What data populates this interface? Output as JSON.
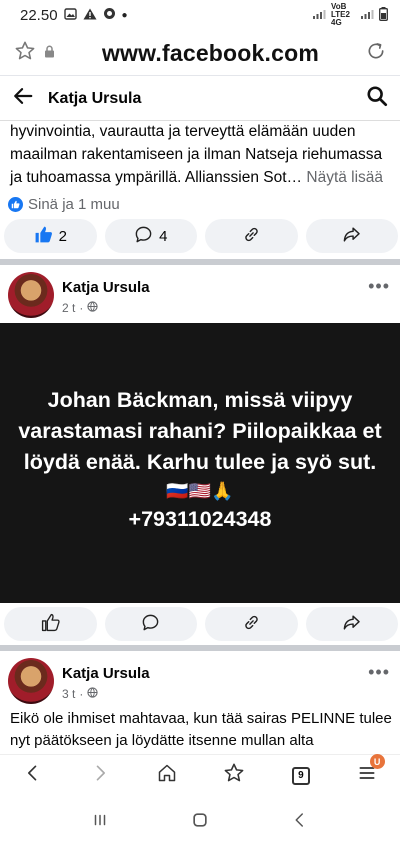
{
  "status": {
    "time": "22.50",
    "network": "VoB LTE2 4G",
    "signal": "signal",
    "battery": "battery"
  },
  "browser": {
    "url": "www.facebook.com"
  },
  "header": {
    "title": "Katja Ursula"
  },
  "post1": {
    "text": "hyvinvointia, vaurautta ja terveyttä elämään uuden maailman rakentamiseen ja ilman Natseja riehumassa ja tuhoamassa ympärillä. Allianssien Sot…",
    "see_more": "Näytä lisää",
    "reactions_text": "Sinä ja 1 muu",
    "like_count": "2",
    "comment_count": "4"
  },
  "post2": {
    "author": "Katja Ursula",
    "time": "2 t",
    "image_line1": "Johan Bäckman, missä viipyy",
    "image_line2": "varastamasi rahani? Piilopaikkaa et",
    "image_line3": "löydä enää. Karhu tulee ja syö sut.",
    "image_emojis": "🇷🇺🇺🇸🙏",
    "image_phone": "+79311024348"
  },
  "post3": {
    "author": "Katja Ursula",
    "time": "3 t",
    "text": "Eikö ole ihmiset mahtavaa, kun tää sairas PELINNE tulee nyt päätökseen ja löydätte itsenne mullan alta"
  },
  "nav": {
    "tab_count": "9",
    "menu_badge": "U"
  },
  "colors": {
    "accent": "#1877f2",
    "meta": "#65676b",
    "button_bg": "#f0f2f5",
    "image_bg": "#151515",
    "badge": "#e8743b"
  }
}
